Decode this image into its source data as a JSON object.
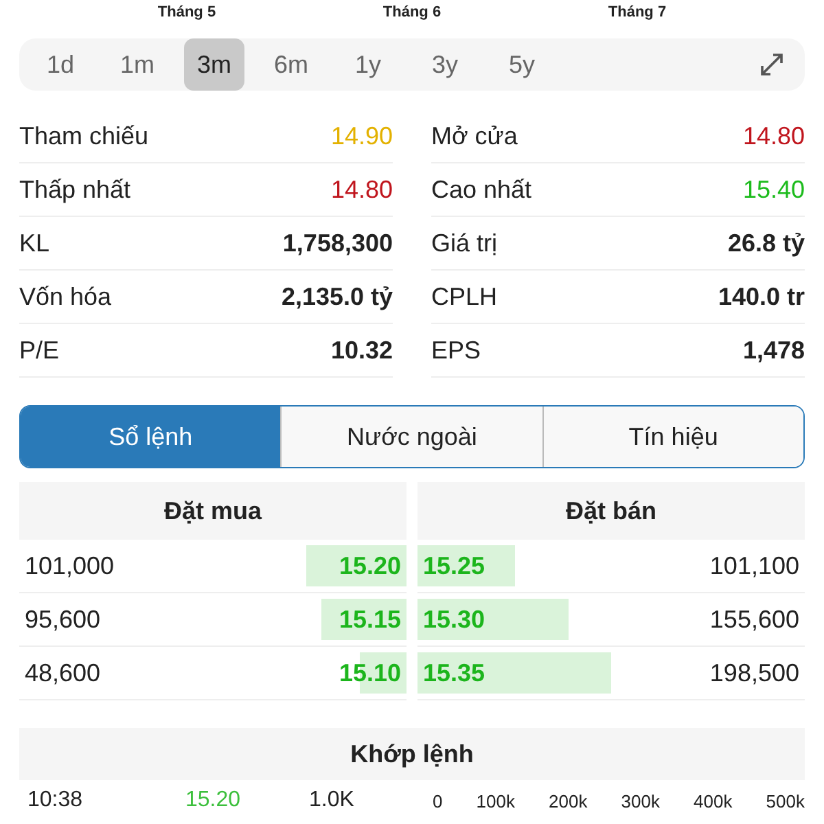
{
  "months": [
    "Tháng 5",
    "Tháng 6",
    "Tháng 7"
  ],
  "periods": [
    {
      "label": "1d",
      "selected": false
    },
    {
      "label": "1m",
      "selected": false
    },
    {
      "label": "3m",
      "selected": true
    },
    {
      "label": "6m",
      "selected": false
    },
    {
      "label": "1y",
      "selected": false
    },
    {
      "label": "3y",
      "selected": false
    },
    {
      "label": "5y",
      "selected": false
    }
  ],
  "stats": [
    {
      "left": {
        "label": "Tham chiếu",
        "value": "14.90",
        "kind": "reference"
      },
      "right": {
        "label": "Mở cửa",
        "value": "14.80",
        "kind": "down"
      }
    },
    {
      "left": {
        "label": "Thấp nhất",
        "value": "14.80",
        "kind": "down"
      },
      "right": {
        "label": "Cao nhất",
        "value": "15.40",
        "kind": "up"
      }
    },
    {
      "left": {
        "label": "KL",
        "value": "1,758,300",
        "kind": "plain"
      },
      "right": {
        "label": "Giá trị",
        "value": "26.8 tỷ",
        "kind": "plain"
      }
    },
    {
      "left": {
        "label": "Vốn hóa",
        "value": "2,135.0 tỷ",
        "kind": "plain"
      },
      "right": {
        "label": "CPLH",
        "value": "140.0 tr",
        "kind": "plain"
      }
    },
    {
      "left": {
        "label": "P/E",
        "value": "10.32",
        "kind": "plain"
      },
      "right": {
        "label": "EPS",
        "value": "1,478",
        "kind": "plain"
      }
    }
  ],
  "tabs": [
    {
      "label": "Sổ lệnh",
      "selected": true
    },
    {
      "label": "Nước ngoài",
      "selected": false
    },
    {
      "label": "Tín hiệu",
      "selected": false
    }
  ],
  "order_book": {
    "bid_title": "Đặt mua",
    "ask_title": "Đặt bán",
    "rows": [
      {
        "bid": {
          "volume": "101,000",
          "price": "15.20",
          "level": 0.26
        },
        "ask": {
          "price": "15.25",
          "level": 0.25,
          "volume": "101,100"
        }
      },
      {
        "bid": {
          "volume": "95,600",
          "price": "15.15",
          "level": 0.22
        },
        "ask": {
          "price": "15.30",
          "level": 0.39,
          "volume": "155,600"
        }
      },
      {
        "bid": {
          "volume": "48,600",
          "price": "15.10",
          "level": 0.12
        },
        "ask": {
          "price": "15.35",
          "level": 0.5,
          "volume": "198,500"
        }
      }
    ]
  },
  "matched": {
    "title": "Khớp lệnh",
    "rows": [
      {
        "time": "10:38",
        "price": "15.20",
        "volume": "1.0K"
      }
    ],
    "axis": [
      "0",
      "100k",
      "200k",
      "300k",
      "400k",
      "500k"
    ]
  }
}
